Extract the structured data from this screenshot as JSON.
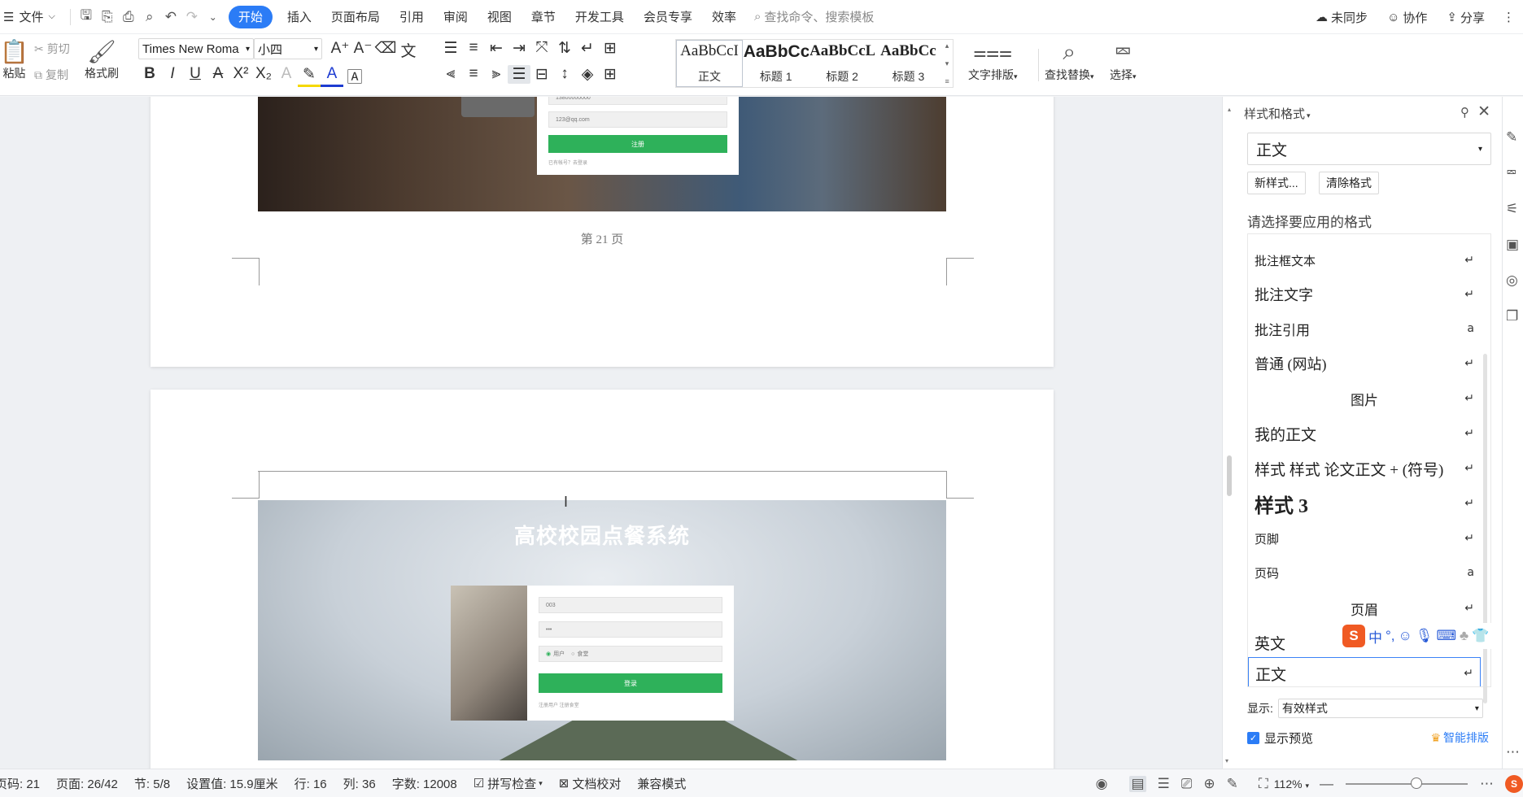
{
  "menubar": {
    "file": "文件",
    "tabs": [
      "开始",
      "插入",
      "页面布局",
      "引用",
      "审阅",
      "视图",
      "章节",
      "开发工具",
      "会员专享",
      "效率"
    ],
    "active_tab": "开始",
    "search_placeholder": "查找命令、搜索模板",
    "sync": "未同步",
    "collab": "协作",
    "share": "分享"
  },
  "ribbon": {
    "paste": "粘贴",
    "cut": "剪切",
    "copy": "复制",
    "format_painter": "格式刷",
    "font_name": "Times New Roma",
    "font_size": "小四",
    "styles": [
      {
        "preview": "AaBbCcI",
        "label": "正文"
      },
      {
        "preview": "AaBbCcI",
        "label": "标题 1"
      },
      {
        "preview": "AaBbCcL",
        "label": "标题 2"
      },
      {
        "preview": "AaBbCc",
        "label": "标题 3"
      }
    ],
    "text_layout": "文字排版",
    "find_replace": "查找替换",
    "select": "选择"
  },
  "document": {
    "page_footer": "第 21 页",
    "photo2_title": "高校校园点餐系统",
    "form1_fields": [
      "13800000000",
      "123@qq.com"
    ],
    "form1_button": "注册",
    "form1_link": "已有帐号？去登录",
    "form2_fields": [
      "003",
      "•••"
    ],
    "form2_radio1": "用户",
    "form2_radio2": "食堂",
    "form2_button": "登录",
    "form2_link": "注册用户  注册食堂"
  },
  "sidepanel": {
    "title": "样式和格式",
    "current_style": "正文",
    "new_style": "新样式...",
    "clear_format": "清除格式",
    "choose_label": "请选择要应用的格式",
    "items": [
      {
        "name": "批注框文本",
        "mark": "↵"
      },
      {
        "name": "批注文字",
        "mark": "↵"
      },
      {
        "name": "批注引用",
        "mark": "a"
      },
      {
        "name": "普通 (网站)",
        "mark": "↵"
      },
      {
        "name": "图片",
        "mark": "↵"
      },
      {
        "name": "我的正文",
        "mark": "↵"
      },
      {
        "name": "样式 样式 论文正文 + (符号)",
        "mark": "↵"
      },
      {
        "name": "样式 3",
        "mark": "↵"
      },
      {
        "name": "页脚",
        "mark": "↵"
      },
      {
        "name": "页码",
        "mark": "a"
      },
      {
        "name": "页眉",
        "mark": "↵"
      },
      {
        "name": "英文",
        "mark": ""
      },
      {
        "name": "正文",
        "mark": "↵"
      }
    ],
    "show_label": "显示:",
    "show_value": "有效样式",
    "show_preview": "显示预览",
    "smart_layout": "智能排版",
    "ime": "中"
  },
  "statusbar": {
    "page_code": "页码: 21",
    "pages": "页面: 26/42",
    "section": "节: 5/8",
    "setting": "设置值: 15.9厘米",
    "row": "行: 16",
    "col": "列: 36",
    "words": "字数: 12008",
    "spell": "拼写检查",
    "proof": "文档校对",
    "compat": "兼容模式",
    "zoom": "112%",
    "zoom_fraction": 0.58
  }
}
